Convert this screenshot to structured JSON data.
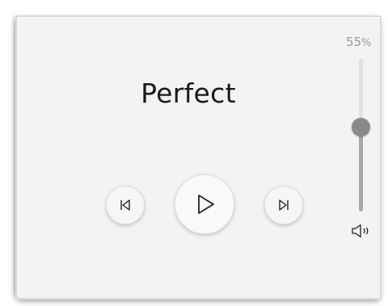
{
  "track": {
    "title": "Perfect"
  },
  "controls": {
    "prev_icon": "skip-previous-icon",
    "play_icon": "play-icon",
    "next_icon": "skip-next-icon"
  },
  "volume": {
    "value_text": "55",
    "unit": "%",
    "level": 0.55,
    "icon": "speaker-icon"
  },
  "colors": {
    "card_background": "#f3f3f3",
    "text": "#1a1a1a",
    "slider_thumb": "#8a8a8a",
    "slider_fill": "#a8a8a8",
    "slider_track": "#e2e2e2",
    "percent_text": "#9a9a9a"
  }
}
